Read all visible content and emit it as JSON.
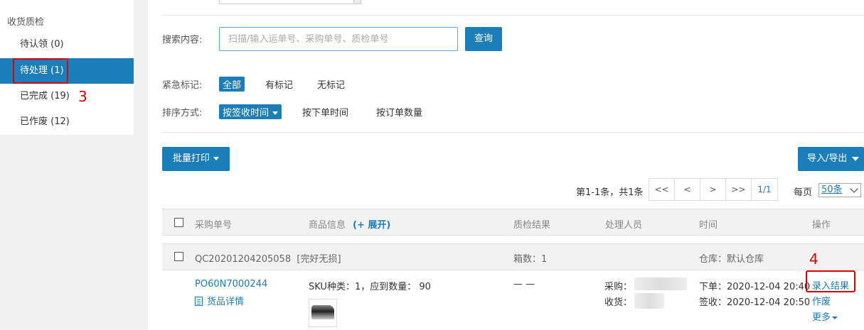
{
  "sidebar": {
    "title": "收货质检",
    "items": [
      {
        "label": "待认领 (0)"
      },
      {
        "label": "待处理 (1)"
      },
      {
        "label": "已完成 (19)"
      },
      {
        "label": "已作废 (12)"
      }
    ],
    "annotation": "3"
  },
  "search": {
    "label": "搜索内容:",
    "placeholder": "扫描/输入运单号、采购单号、质检单号",
    "button": "查询"
  },
  "urgency": {
    "label": "紧急标记:",
    "options": [
      "全部",
      "有标记",
      "无标记"
    ],
    "selected": "全部"
  },
  "sort": {
    "label": "排序方式:",
    "options": [
      "按签收时间",
      "按下单时间",
      "按订单数量"
    ],
    "selected": "按签收时间"
  },
  "toolbar": {
    "batch_print": "批量打印",
    "import_export": "导入/导出"
  },
  "pagination": {
    "info": "第1-1条，共1条",
    "buttons": [
      "<<",
      "<",
      ">",
      ">>",
      "1/1"
    ],
    "per_page_label": "每页",
    "per_page_value": "50条"
  },
  "table": {
    "columns": {
      "po": "采购单号",
      "product": "商品信息",
      "expand": "(+ 展开)",
      "qc_result": "质检结果",
      "handler": "处理人员",
      "time": "时间",
      "action": "操作"
    },
    "group": {
      "qc_no": "QC20201204205058",
      "condition": "[完好无损]",
      "boxes": "箱数：1",
      "warehouse": "仓库：默认仓库"
    },
    "row": {
      "po_no": "PO60N7000244",
      "goods_detail": "货品详情",
      "sku": "SKU种类：1，应到数量： 90",
      "qc_result": "— —",
      "purchaser_label": "采购：",
      "receiver_label": "收货：",
      "order_time": "下单：2020-12-04 20:40",
      "sign_time": "签收：2020-12-04 20:50",
      "actions": {
        "enter_result": "录入结果",
        "void": "作废",
        "more": "更多"
      }
    },
    "annotation": "4"
  },
  "colors": {
    "primary": "#1c7eb9",
    "highlight": "#e30000"
  }
}
